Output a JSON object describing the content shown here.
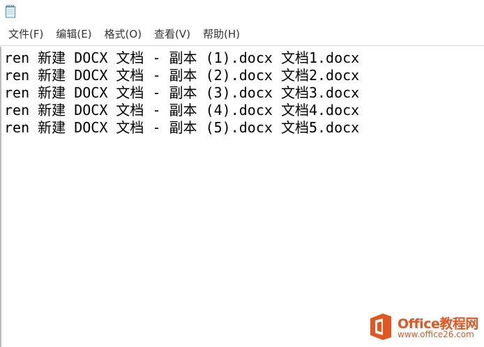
{
  "menu": {
    "items": [
      {
        "label": "文件(F)"
      },
      {
        "label": "编辑(E)"
      },
      {
        "label": "格式(O)"
      },
      {
        "label": "查看(V)"
      },
      {
        "label": "帮助(H)"
      }
    ]
  },
  "editor": {
    "lines": [
      "ren 新建 DOCX 文档 - 副本 (1).docx 文档1.docx",
      "ren 新建 DOCX 文档 - 副本 (2).docx 文档2.docx",
      "ren 新建 DOCX 文档 - 副本 (3).docx 文档3.docx",
      "ren 新建 DOCX 文档 - 副本 (4).docx 文档4.docx",
      "ren 新建 DOCX 文档 - 副本 (5).docx 文档5.docx"
    ]
  },
  "watermark": {
    "brand": "Office教程网",
    "url": "www.office26.com",
    "color": "#e8541e"
  },
  "icons": {
    "app": "notepad-icon",
    "watermark": "office-logo-icon"
  }
}
